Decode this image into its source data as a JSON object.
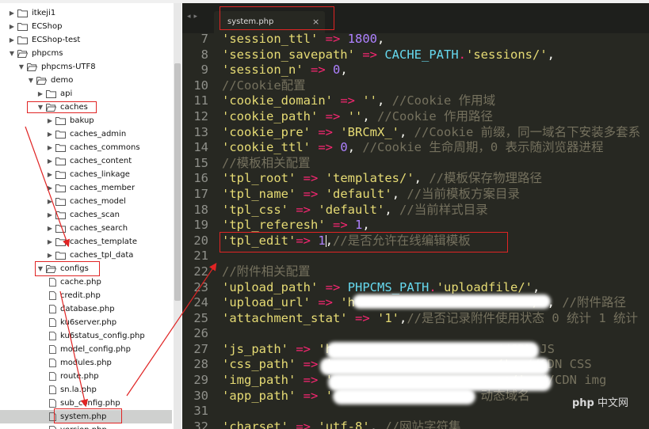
{
  "sidebar": {
    "items": [
      {
        "label": "itkeji1",
        "depth": 0,
        "kind": "folder",
        "expanded": false
      },
      {
        "label": "ECShop",
        "depth": 0,
        "kind": "folder",
        "expanded": false
      },
      {
        "label": "ECShop-test",
        "depth": 0,
        "kind": "folder",
        "expanded": false
      },
      {
        "label": "phpcms",
        "depth": 0,
        "kind": "folder",
        "expanded": true
      },
      {
        "label": "phpcms-UTF8",
        "depth": 1,
        "kind": "folder",
        "expanded": true
      },
      {
        "label": "demo",
        "depth": 2,
        "kind": "folder",
        "expanded": true
      },
      {
        "label": "api",
        "depth": 3,
        "kind": "folder",
        "expanded": false
      },
      {
        "label": "caches",
        "depth": 3,
        "kind": "folder",
        "expanded": true
      },
      {
        "label": "bakup",
        "depth": 4,
        "kind": "folder",
        "expanded": false
      },
      {
        "label": "caches_admin",
        "depth": 4,
        "kind": "folder",
        "expanded": false
      },
      {
        "label": "caches_commons",
        "depth": 4,
        "kind": "folder",
        "expanded": false
      },
      {
        "label": "caches_content",
        "depth": 4,
        "kind": "folder",
        "expanded": false
      },
      {
        "label": "caches_linkage",
        "depth": 4,
        "kind": "folder",
        "expanded": false
      },
      {
        "label": "caches_member",
        "depth": 4,
        "kind": "folder",
        "expanded": false
      },
      {
        "label": "caches_model",
        "depth": 4,
        "kind": "folder",
        "expanded": false
      },
      {
        "label": "caches_scan",
        "depth": 4,
        "kind": "folder",
        "expanded": false
      },
      {
        "label": "caches_search",
        "depth": 4,
        "kind": "folder",
        "expanded": false
      },
      {
        "label": "caches_template",
        "depth": 4,
        "kind": "folder",
        "expanded": false
      },
      {
        "label": "caches_tpl_data",
        "depth": 4,
        "kind": "folder",
        "expanded": false
      },
      {
        "label": "configs",
        "depth": 3,
        "kind": "folder",
        "expanded": true
      },
      {
        "label": "cache.php",
        "depth": 4,
        "kind": "file"
      },
      {
        "label": "credit.php",
        "depth": 4,
        "kind": "file"
      },
      {
        "label": "database.php",
        "depth": 4,
        "kind": "file"
      },
      {
        "label": "ku6server.php",
        "depth": 4,
        "kind": "file"
      },
      {
        "label": "ku6status_config.php",
        "depth": 4,
        "kind": "file"
      },
      {
        "label": "model_config.php",
        "depth": 4,
        "kind": "file"
      },
      {
        "label": "modules.php",
        "depth": 4,
        "kind": "file"
      },
      {
        "label": "route.php",
        "depth": 4,
        "kind": "file"
      },
      {
        "label": "sn.la.php",
        "depth": 4,
        "kind": "file"
      },
      {
        "label": "sub_config.php",
        "depth": 4,
        "kind": "file"
      },
      {
        "label": "system.php",
        "depth": 4,
        "kind": "file",
        "selected": true
      },
      {
        "label": "version.php",
        "depth": 4,
        "kind": "file"
      }
    ]
  },
  "editor": {
    "tab": {
      "name": "system.php",
      "close": "×"
    },
    "lines": [
      {
        "num": "7",
        "tokens": [
          [
            "s",
            "'session_ttl'"
          ],
          [
            "w",
            " "
          ],
          [
            "o",
            "=>"
          ],
          [
            "w",
            " "
          ],
          [
            "n",
            "1800"
          ],
          [
            "w",
            ","
          ]
        ]
      },
      {
        "num": "8",
        "tokens": [
          [
            "s",
            "'session_savepath'"
          ],
          [
            "w",
            " "
          ],
          [
            "o",
            "=>"
          ],
          [
            "w",
            " "
          ],
          [
            "k",
            "CACHE_PATH"
          ],
          [
            "o",
            "."
          ],
          [
            "s",
            "'sessions/'"
          ],
          [
            "w",
            ","
          ]
        ]
      },
      {
        "num": "9",
        "tokens": [
          [
            "s",
            "'session_n'"
          ],
          [
            "w",
            " "
          ],
          [
            "o",
            "=>"
          ],
          [
            "w",
            " "
          ],
          [
            "n",
            "0"
          ],
          [
            "w",
            ","
          ]
        ]
      },
      {
        "num": "10",
        "tokens": [
          [
            "c",
            "//Cookie配置"
          ]
        ]
      },
      {
        "num": "11",
        "tokens": [
          [
            "s",
            "'cookie_domain'"
          ],
          [
            "w",
            " "
          ],
          [
            "o",
            "=>"
          ],
          [
            "w",
            " "
          ],
          [
            "s",
            "''"
          ],
          [
            "w",
            ", "
          ],
          [
            "c",
            "//Cookie 作用域"
          ]
        ]
      },
      {
        "num": "12",
        "tokens": [
          [
            "s",
            "'cookie_path'"
          ],
          [
            "w",
            " "
          ],
          [
            "o",
            "=>"
          ],
          [
            "w",
            " "
          ],
          [
            "s",
            "''"
          ],
          [
            "w",
            ", "
          ],
          [
            "c",
            "//Cookie 作用路径"
          ]
        ]
      },
      {
        "num": "13",
        "tokens": [
          [
            "s",
            "'cookie_pre'"
          ],
          [
            "w",
            " "
          ],
          [
            "o",
            "=>"
          ],
          [
            "w",
            " "
          ],
          [
            "s",
            "'BRCmX_'"
          ],
          [
            "w",
            ", "
          ],
          [
            "c",
            "//Cookie 前缀，同一域名下安装多套系"
          ]
        ]
      },
      {
        "num": "14",
        "tokens": [
          [
            "s",
            "'cookie_ttl'"
          ],
          [
            "w",
            " "
          ],
          [
            "o",
            "=>"
          ],
          [
            "w",
            " "
          ],
          [
            "n",
            "0"
          ],
          [
            "w",
            ", "
          ],
          [
            "c",
            "//Cookie 生命周期，0 表示随浏览器进程"
          ]
        ]
      },
      {
        "num": "15",
        "tokens": [
          [
            "c",
            "//模板相关配置"
          ]
        ]
      },
      {
        "num": "16",
        "tokens": [
          [
            "s",
            "'tpl_root'"
          ],
          [
            "w",
            " "
          ],
          [
            "o",
            "=>"
          ],
          [
            "w",
            " "
          ],
          [
            "s",
            "'templates/'"
          ],
          [
            "w",
            ", "
          ],
          [
            "c",
            "//模板保存物理路径"
          ]
        ]
      },
      {
        "num": "17",
        "tokens": [
          [
            "s",
            "'tpl_name'"
          ],
          [
            "w",
            " "
          ],
          [
            "o",
            "=>"
          ],
          [
            "w",
            " "
          ],
          [
            "s",
            "'default'"
          ],
          [
            "w",
            ", "
          ],
          [
            "c",
            "//当前模板方案目录"
          ]
        ]
      },
      {
        "num": "18",
        "tokens": [
          [
            "s",
            "'tpl_css'"
          ],
          [
            "w",
            " "
          ],
          [
            "o",
            "=>"
          ],
          [
            "w",
            " "
          ],
          [
            "s",
            "'default'"
          ],
          [
            "w",
            ", "
          ],
          [
            "c",
            "//当前样式目录"
          ]
        ]
      },
      {
        "num": "19",
        "tokens": [
          [
            "s",
            "'tpl_referesh'"
          ],
          [
            "w",
            " "
          ],
          [
            "o",
            "=>"
          ],
          [
            "w",
            " "
          ],
          [
            "n",
            "1"
          ],
          [
            "w",
            ","
          ]
        ]
      },
      {
        "num": "20",
        "tokens": [
          [
            "s",
            "'tpl_edit'"
          ],
          [
            "o",
            "=>"
          ],
          [
            "w",
            " "
          ],
          [
            "n",
            "1"
          ],
          [
            "cursor",
            ""
          ],
          [
            "w",
            ","
          ],
          [
            "c",
            "//是否允许在线编辑模板"
          ]
        ]
      },
      {
        "num": "21",
        "tokens": []
      },
      {
        "num": "22",
        "tokens": [
          [
            "c",
            "//附件相关配置"
          ]
        ]
      },
      {
        "num": "23",
        "tokens": [
          [
            "s",
            "'upload_path'"
          ],
          [
            "w",
            " "
          ],
          [
            "o",
            "=>"
          ],
          [
            "w",
            " "
          ],
          [
            "k",
            "PHPCMS_PATH"
          ],
          [
            "o",
            "."
          ],
          [
            "s",
            "'uploadfile/'"
          ],
          [
            "w",
            ","
          ]
        ]
      },
      {
        "num": "24",
        "tokens": [
          [
            "s",
            "'upload_url'"
          ],
          [
            "w",
            " "
          ],
          [
            "o",
            "=>"
          ],
          [
            "w",
            " "
          ],
          [
            "s",
            "'h"
          ],
          [
            "w",
            "                        "
          ],
          [
            "s",
            "/'"
          ],
          [
            "w",
            ", "
          ],
          [
            "c",
            "//附件路径"
          ]
        ]
      },
      {
        "num": "25",
        "tokens": [
          [
            "s",
            "'attachment_stat'"
          ],
          [
            "w",
            " "
          ],
          [
            "o",
            "=>"
          ],
          [
            "w",
            " "
          ],
          [
            "s",
            "'1'"
          ],
          [
            "w",
            ","
          ],
          [
            "c",
            "//是否记录附件使用状态 0 统计 1 统计"
          ]
        ]
      },
      {
        "num": "26",
        "tokens": []
      },
      {
        "num": "27",
        "tokens": [
          [
            "s",
            "'js_path'"
          ],
          [
            "w",
            " "
          ],
          [
            "o",
            "=>"
          ],
          [
            "w",
            " "
          ],
          [
            "s",
            "'h"
          ],
          [
            "w",
            "                    "
          ],
          [
            "w",
            ", "
          ],
          [
            "c",
            "//CDN JS"
          ]
        ]
      },
      {
        "num": "28",
        "tokens": [
          [
            "s",
            "'css_path'"
          ],
          [
            "w",
            " "
          ],
          [
            "o",
            "=>"
          ],
          [
            "w",
            " "
          ],
          [
            "s",
            "'"
          ],
          [
            "w",
            "                      "
          ],
          [
            "s",
            "/'"
          ],
          [
            "w",
            ", "
          ],
          [
            "c",
            "//CDN CSS"
          ]
        ]
      },
      {
        "num": "29",
        "tokens": [
          [
            "s",
            "'img_path'"
          ],
          [
            "w",
            " "
          ],
          [
            "o",
            "=>"
          ],
          [
            "w",
            " "
          ],
          [
            "s",
            "'"
          ],
          [
            "w",
            "                      "
          ],
          [
            "s",
            "es/'"
          ],
          [
            "w",
            ", "
          ],
          [
            "c",
            "//CDN img"
          ]
        ]
      },
      {
        "num": "30",
        "tokens": [
          [
            "s",
            "'app_path'"
          ],
          [
            "w",
            " "
          ],
          [
            "o",
            "=>"
          ],
          [
            "w",
            " "
          ],
          [
            "s",
            "'"
          ],
          [
            "w",
            "                    "
          ],
          [
            "c",
            "动态域名"
          ]
        ]
      },
      {
        "num": "31",
        "tokens": []
      },
      {
        "num": "32",
        "tokens": [
          [
            "s",
            "'charset'"
          ],
          [
            "w",
            " "
          ],
          [
            "o",
            "=>"
          ],
          [
            "w",
            " "
          ],
          [
            "s",
            "'utf-8'"
          ],
          [
            "w",
            ", "
          ],
          [
            "c",
            "//网站字符集"
          ]
        ]
      }
    ]
  },
  "watermark": {
    "text": "php",
    "suffix": "中文网"
  },
  "colors": {
    "annotation_red": "#e02424",
    "editor_bg": "#272822",
    "string": "#e6db74",
    "comment": "#75715e",
    "constant": "#66d9ef",
    "number": "#ae81ff",
    "operator": "#f92672"
  }
}
